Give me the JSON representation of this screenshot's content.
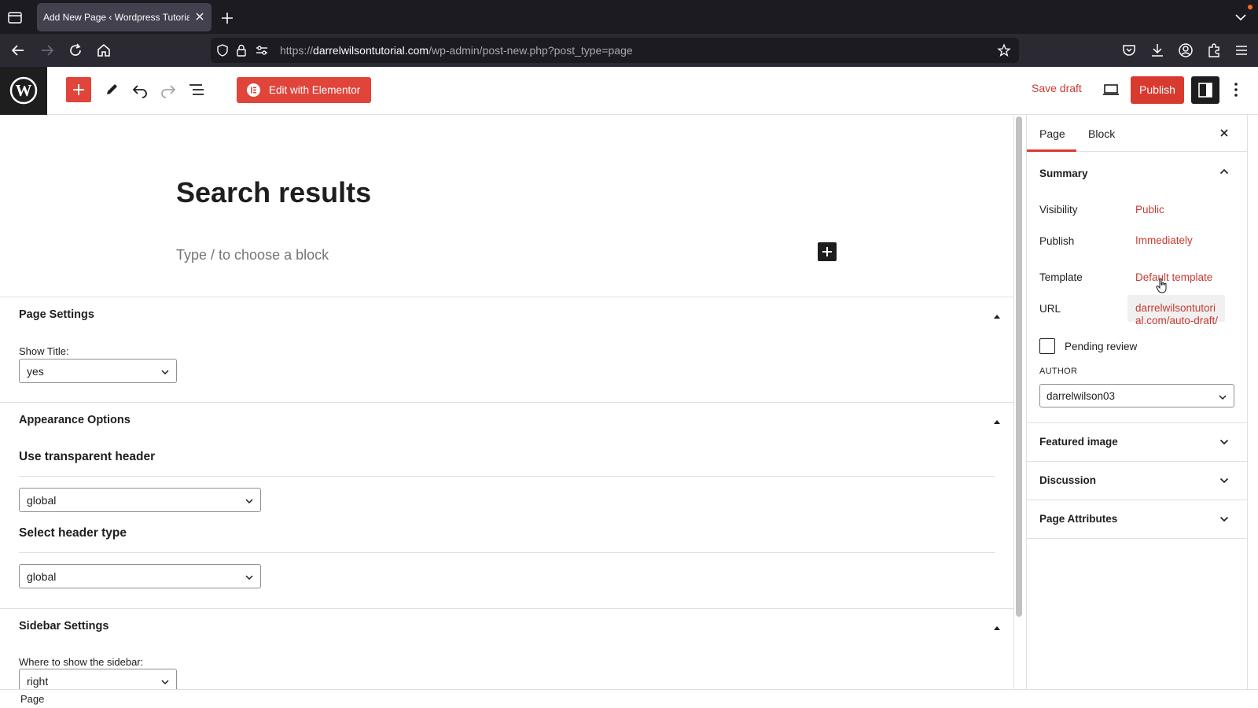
{
  "browser": {
    "tab_title": "Add New Page ‹ Wordpress Tutorial",
    "url_prefix": "https://",
    "url_domain": "darrelwilsontutorial.com",
    "url_path": "/wp-admin/post-new.php?post_type=page"
  },
  "toolbar": {
    "elementor_label": "Edit with Elementor",
    "save_draft_label": "Save draft",
    "publish_label": "Publish"
  },
  "editor": {
    "title": "Search results",
    "placeholder": "Type / to choose a block"
  },
  "metaboxes": {
    "page_settings": {
      "title": "Page Settings",
      "show_title_label": "Show Title:",
      "show_title_value": "yes"
    },
    "appearance": {
      "title": "Appearance Options",
      "transparent_header_label": "Use transparent header",
      "transparent_header_value": "global",
      "header_type_label": "Select header type",
      "header_type_value": "global"
    },
    "sidebar_settings": {
      "title": "Sidebar Settings",
      "where_label": "Where to show the sidebar:",
      "where_value": "right"
    }
  },
  "footer": {
    "breadcrumb": "Page"
  },
  "sidebar": {
    "tabs": [
      "Page",
      "Block"
    ],
    "summary": {
      "title": "Summary",
      "visibility_label": "Visibility",
      "visibility_value": "Public",
      "publish_label": "Publish",
      "publish_value": "Immediately",
      "template_label": "Template",
      "template_value": "Default template",
      "url_label": "URL",
      "url_value_line1": "darrelwilsontutori",
      "url_value_line2": "al.com/auto-draft/",
      "pending_review_label": "Pending review",
      "author_caption": "AUTHOR",
      "author_value": "darrelwilson03"
    },
    "panels": [
      "Featured image",
      "Discussion",
      "Page Attributes"
    ]
  },
  "colors": {
    "accent": "#d93a30",
    "dark": "#1e1e1e",
    "browser_chrome": "#1c1b22"
  }
}
